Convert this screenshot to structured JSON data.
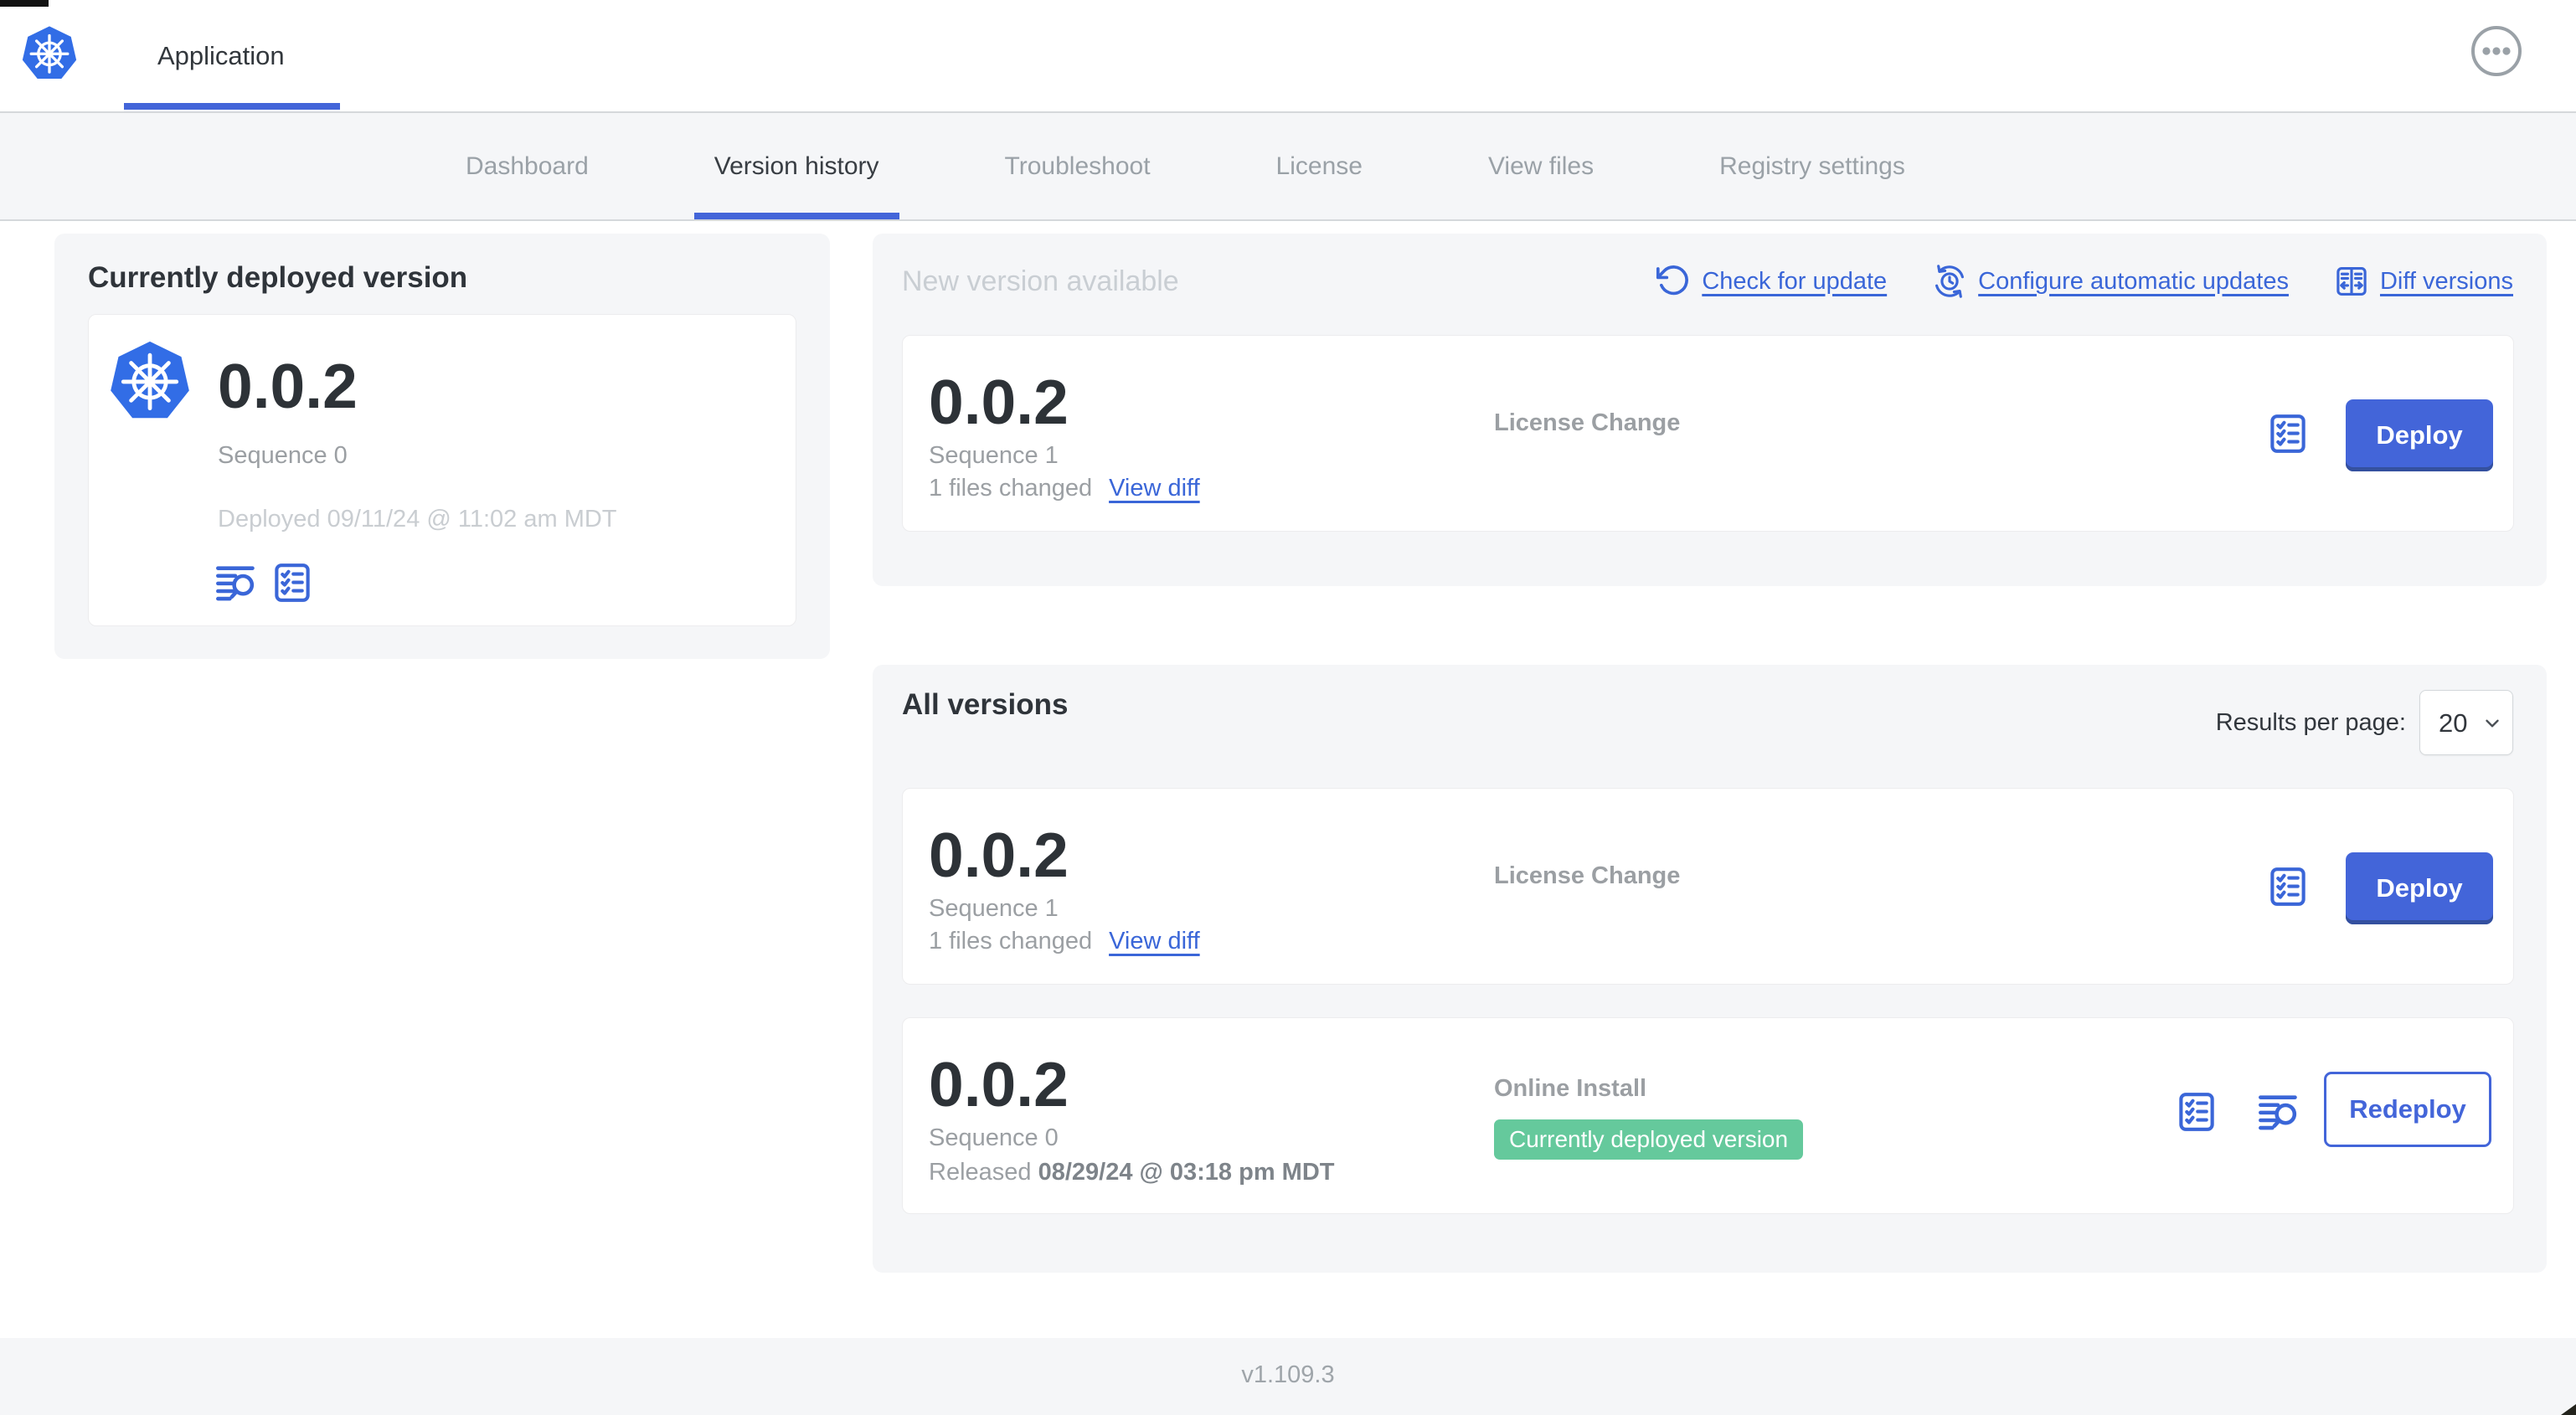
{
  "colors": {
    "accent_blue": "#3a66d8",
    "button_blue": "#4365d9",
    "logo_blue": "#326de6",
    "badge_green": "#65c99c",
    "panel_gray": "#f5f6f8"
  },
  "icons": {
    "brand": "kubernetes-logo",
    "menu": "ellipsis-circle",
    "check_for_update": "rotate-ccw-arrow",
    "configure_updates": "clock-with-sync-arrows",
    "diff_versions": "split-pane-diff",
    "release_notes": "text-lines-magnifier",
    "preflight_checks": "checklist",
    "select_chevron": "chevron-down"
  },
  "topbar": {
    "app_tab": "Application"
  },
  "nav": {
    "tabs": [
      {
        "label": "Dashboard",
        "active": false
      },
      {
        "label": "Version history",
        "active": true
      },
      {
        "label": "Troubleshoot",
        "active": false
      },
      {
        "label": "License",
        "active": false
      },
      {
        "label": "View files",
        "active": false
      },
      {
        "label": "Registry settings",
        "active": false
      }
    ]
  },
  "current_deployed": {
    "title": "Currently deployed version",
    "version": "0.0.2",
    "sequence": "Sequence 0",
    "deployed_at": "Deployed 09/11/24 @ 11:02 am MDT"
  },
  "new_version": {
    "title": "New version available",
    "check_for_update": "Check for update",
    "configure_automatic_updates": "Configure automatic updates",
    "diff_versions": "Diff versions",
    "card": {
      "version": "0.0.2",
      "sequence": "Sequence 1",
      "files_changed": "1 files changed",
      "view_diff": "View diff",
      "source": "License Change",
      "action": "Deploy"
    }
  },
  "all_versions": {
    "title": "All versions",
    "results_per_page_label": "Results per page:",
    "results_per_page_value": "20",
    "rows": [
      {
        "version": "0.0.2",
        "sequence": "Sequence 1",
        "files_changed": "1 files changed",
        "view_diff": "View diff",
        "source": "License Change",
        "action": "Deploy"
      },
      {
        "version": "0.0.2",
        "sequence": "Sequence 0",
        "released_prefix": "Released",
        "released_date": "08/29/24 @ 03:18 pm MDT",
        "source": "Online Install",
        "badge": "Currently deployed version",
        "action": "Redeploy"
      }
    ]
  },
  "footer": {
    "app_version": "v1.109.3"
  }
}
